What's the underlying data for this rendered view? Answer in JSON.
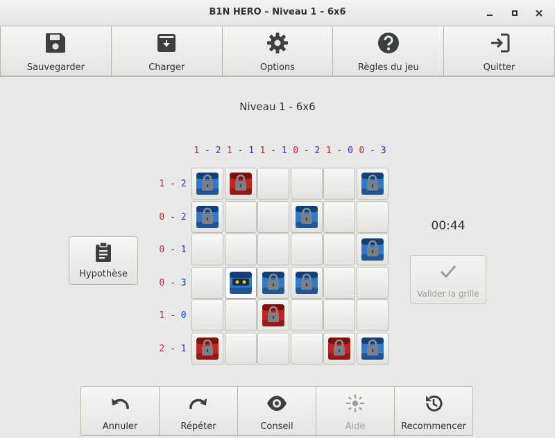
{
  "window": {
    "title": "B1N HERO – Niveau 1 – 6x6",
    "controls": [
      "minimize",
      "maximize",
      "close"
    ]
  },
  "toolbar": {
    "items": [
      {
        "label": "Sauvegarder",
        "icon": "save-icon"
      },
      {
        "label": "Charger",
        "icon": "load-icon"
      },
      {
        "label": "Options",
        "icon": "gear-icon"
      },
      {
        "label": "Règles du jeu",
        "icon": "help-icon"
      },
      {
        "label": "Quitter",
        "icon": "exit-icon"
      }
    ]
  },
  "level": {
    "title": "Niveau 1 - 6x6"
  },
  "columns": [
    {
      "red": "1",
      "blue": "2"
    },
    {
      "red": "1",
      "blue": "1"
    },
    {
      "red": "1",
      "blue": "1"
    },
    {
      "red": "0",
      "blue": "2"
    },
    {
      "red": "1",
      "blue": "0"
    },
    {
      "red": "0",
      "blue": "3"
    }
  ],
  "rows": [
    {
      "red": "1",
      "blue": "2"
    },
    {
      "red": "0",
      "blue": "2"
    },
    {
      "red": "0",
      "blue": "1"
    },
    {
      "red": "0",
      "blue": "3"
    },
    {
      "red": "1",
      "blue": "0"
    },
    {
      "red": "2",
      "blue": "1"
    }
  ],
  "grid": [
    [
      "blue-locked",
      "red-locked",
      "",
      "",
      "",
      "blue-locked"
    ],
    [
      "blue-locked",
      "",
      "",
      "blue-locked",
      "",
      ""
    ],
    [
      "",
      "",
      "",
      "",
      "",
      "blue-locked"
    ],
    [
      "",
      "blue-robot",
      "blue-locked",
      "blue-locked",
      "",
      ""
    ],
    [
      "",
      "",
      "red-locked",
      "",
      "",
      ""
    ],
    [
      "red-locked",
      "",
      "",
      "",
      "red-locked",
      "blue-locked"
    ]
  ],
  "selected_cell": {
    "row": 3,
    "col": 1
  },
  "hypothesis": {
    "label": "Hypothèse",
    "icon": "clipboard-icon"
  },
  "timer": {
    "value": "00:44"
  },
  "validate": {
    "label": "Valider la grille",
    "icon": "checkmark-icon",
    "enabled": false
  },
  "bottom": {
    "items": [
      {
        "label": "Annuler",
        "icon": "undo-icon",
        "enabled": true
      },
      {
        "label": "Répéter",
        "icon": "redo-icon",
        "enabled": true
      },
      {
        "label": "Conseil",
        "icon": "eye-icon",
        "enabled": true
      },
      {
        "label": "Aide",
        "icon": "sun-icon",
        "enabled": false
      },
      {
        "label": "Recommencer",
        "icon": "restart-icon",
        "enabled": true
      }
    ]
  },
  "colors": {
    "red_count": "#e01b24",
    "blue_count": "#1c3bd4",
    "blue_piece": "#2f79c9",
    "red_piece": "#c9211e"
  }
}
